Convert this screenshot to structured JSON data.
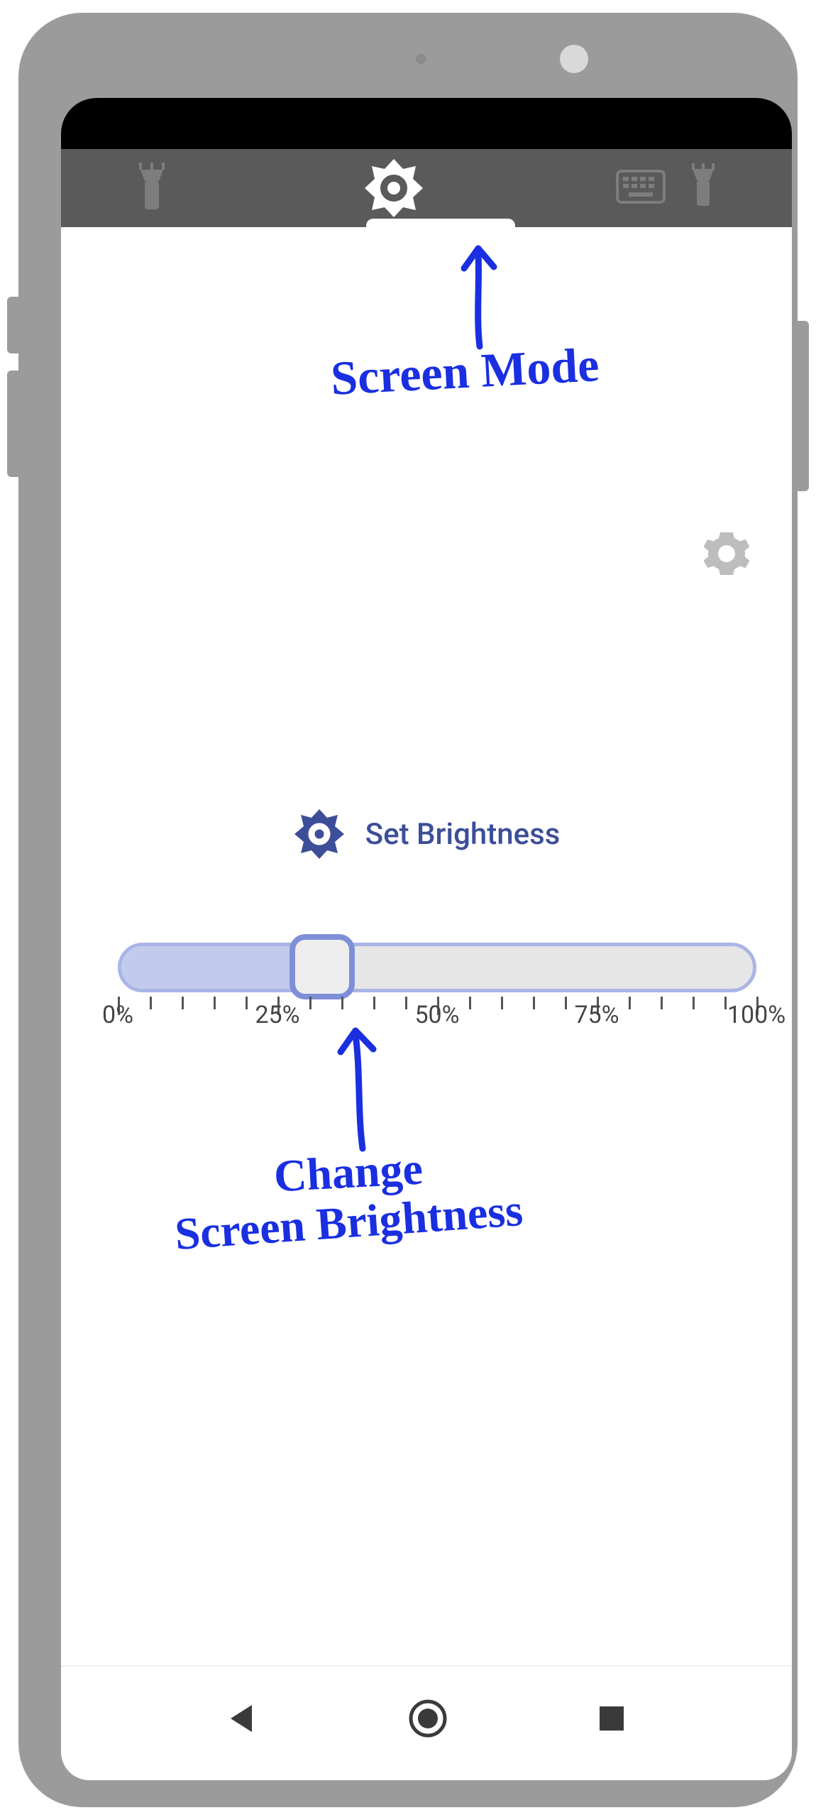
{
  "colors": {
    "frame": "#9b9b9b",
    "toolbar": "#5a5a5a",
    "accent": "#3d4e99",
    "slider_border": "#7e8fd8",
    "slider_fill": "#c3cbec",
    "annotation": "#1a2fe0"
  },
  "toolbar": {
    "left_tab_icon": "flashlight-icon",
    "center_tab_icon": "brightness-icon",
    "right_tab_icons": [
      "keyboard-icon",
      "flashlight-icon"
    ],
    "active_tab_index": 1
  },
  "settings_icon": "gear-icon",
  "brightness": {
    "label": "Set Brightness",
    "value_percent": 32,
    "tick_labels": [
      "0%",
      "25%",
      "50%",
      "75%",
      "100%"
    ]
  },
  "annotations": {
    "top": "Screen Mode",
    "slider_line1": "Change",
    "slider_line2": "Screen Brightness"
  },
  "nav": {
    "back": "back-triangle",
    "home": "home-circle",
    "recent": "recent-square"
  }
}
